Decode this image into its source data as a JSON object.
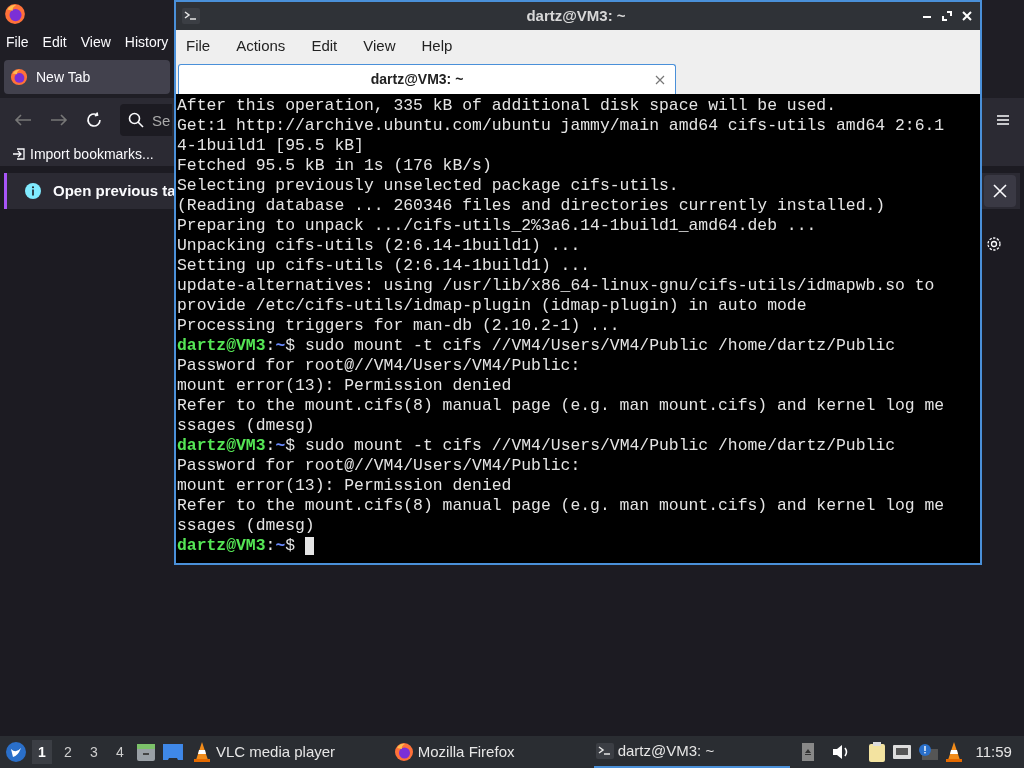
{
  "browser": {
    "menu": [
      "File",
      "Edit",
      "View",
      "History"
    ],
    "tab": {
      "label": "New Tab",
      "selected": true
    },
    "search": {
      "placeholder": "Se"
    },
    "bookmarks": [
      "Import bookmarks..."
    ],
    "notification": "Open previous ta"
  },
  "terminal": {
    "title": "dartz@VM3: ~",
    "menu": [
      "File",
      "Actions",
      "Edit",
      "View",
      "Help"
    ],
    "tabs": [
      {
        "label": "dartz@VM3: ~",
        "selected": true
      }
    ],
    "cursor_visible": true,
    "lines": [
      {
        "kind": "output",
        "text": "After this operation, 335 kB of additional disk space will be used."
      },
      {
        "kind": "output",
        "text": "Get:1 http://archive.ubuntu.com/ubuntu jammy/main amd64 cifs-utils amd64 2:6.1"
      },
      {
        "kind": "output",
        "text": "4-1build1 [95.5 kB]"
      },
      {
        "kind": "output",
        "text": "Fetched 95.5 kB in 1s (176 kB/s)"
      },
      {
        "kind": "output",
        "text": "Selecting previously unselected package cifs-utils."
      },
      {
        "kind": "output",
        "text": "(Reading database ... 260346 files and directories currently installed.)"
      },
      {
        "kind": "output",
        "text": "Preparing to unpack .../cifs-utils_2%3a6.14-1build1_amd64.deb ..."
      },
      {
        "kind": "output",
        "text": "Unpacking cifs-utils (2:6.14-1build1) ..."
      },
      {
        "kind": "output",
        "text": "Setting up cifs-utils (2:6.14-1build1) ..."
      },
      {
        "kind": "output",
        "text": "update-alternatives: using /usr/lib/x86_64-linux-gnu/cifs-utils/idmapwb.so to"
      },
      {
        "kind": "output",
        "text": "provide /etc/cifs-utils/idmap-plugin (idmap-plugin) in auto mode"
      },
      {
        "kind": "output",
        "text": "Processing triggers for man-db (2.10.2-1) ..."
      },
      {
        "kind": "prompt",
        "user": "dartz@VM3",
        "sep": ":",
        "path": "~",
        "command": "$ sudo mount -t cifs //VM4/Users/VM4/Public /home/dartz/Public"
      },
      {
        "kind": "output",
        "text": "Password for root@//VM4/Users/VM4/Public:"
      },
      {
        "kind": "output",
        "text": "mount error(13): Permission denied"
      },
      {
        "kind": "output",
        "text": "Refer to the mount.cifs(8) manual page (e.g. man mount.cifs) and kernel log me"
      },
      {
        "kind": "output",
        "text": "ssages (dmesg)"
      },
      {
        "kind": "prompt",
        "user": "dartz@VM3",
        "sep": ":",
        "path": "~",
        "command": "$ sudo mount -t cifs //VM4/Users/VM4/Public /home/dartz/Public"
      },
      {
        "kind": "output",
        "text": "Password for root@//VM4/Users/VM4/Public:"
      },
      {
        "kind": "output",
        "text": "mount error(13): Permission denied"
      },
      {
        "kind": "output",
        "text": "Refer to the mount.cifs(8) manual page (e.g. man mount.cifs) and kernel log me"
      },
      {
        "kind": "output",
        "text": "ssages (dmesg)"
      },
      {
        "kind": "prompt",
        "user": "dartz@VM3",
        "sep": ":",
        "path": "~",
        "command": "$ "
      }
    ]
  },
  "taskbar": {
    "workspaces": [
      {
        "label": "1",
        "selected": true
      },
      {
        "label": "2",
        "selected": false
      },
      {
        "label": "3",
        "selected": false
      },
      {
        "label": "4",
        "selected": false
      }
    ],
    "tasks": [
      {
        "kind": "vlc",
        "label": "VLC media player",
        "selected": false
      },
      {
        "kind": "firefox",
        "label": "Mozilla Firefox",
        "selected": false
      },
      {
        "kind": "terminal",
        "label": "dartz@VM3: ~",
        "selected": true
      }
    ],
    "clock": "11:59"
  }
}
